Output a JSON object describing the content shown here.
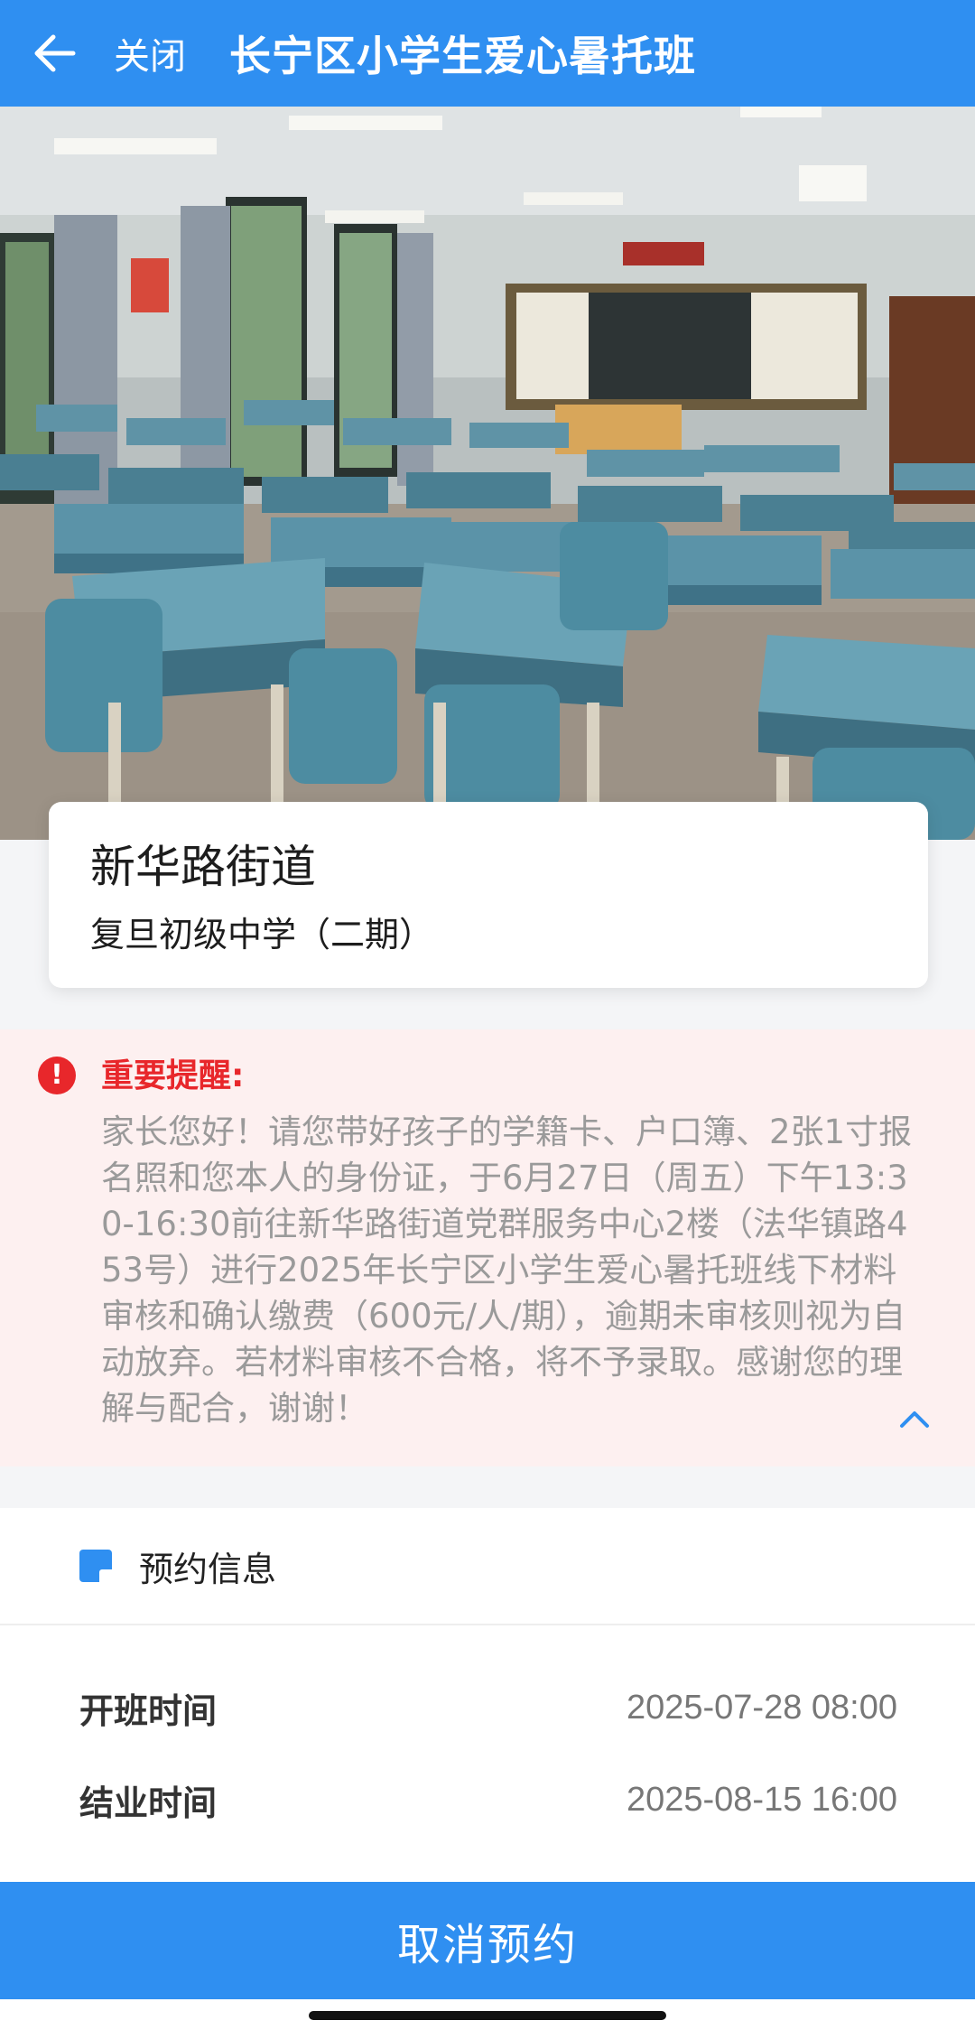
{
  "header": {
    "back_icon": "arrow-left-icon",
    "close_label": "关闭",
    "title": "长宁区小学生爱心暑托班"
  },
  "hero": {
    "image_subject": "classroom-photo"
  },
  "location": {
    "street": "新华路街道",
    "school": "复旦初级中学（二期）"
  },
  "notice": {
    "icon": "exclamation-circle-icon",
    "title": "重要提醒:",
    "text": "家长您好！请您带好孩子的学籍卡、户口簿、2张1寸报名照和您本人的身份证，于6月27日（周五）下午13:30-16:30前往新华路街道党群服务中心2楼（法华镇路453号）进行2025年长宁区小学生爱心暑托班线下材料审核和确认缴费（600元/人/期），逾期未审核则视为自动放弃。若材料审核不合格，将不予录取。感谢您的理解与配合，谢谢！",
    "collapse_icon": "chevron-up-icon",
    "accent_color": "#e8272b"
  },
  "booking": {
    "section_title": "预约信息",
    "rows": [
      {
        "label": "开班时间",
        "value": "2025-07-28 08:00"
      },
      {
        "label": "结业时间",
        "value": "2025-08-15 16:00"
      }
    ]
  },
  "footer": {
    "cancel_label": "取消预约"
  },
  "colors": {
    "brand": "#2f8ff1",
    "notice_bg": "#fdf0f0"
  }
}
